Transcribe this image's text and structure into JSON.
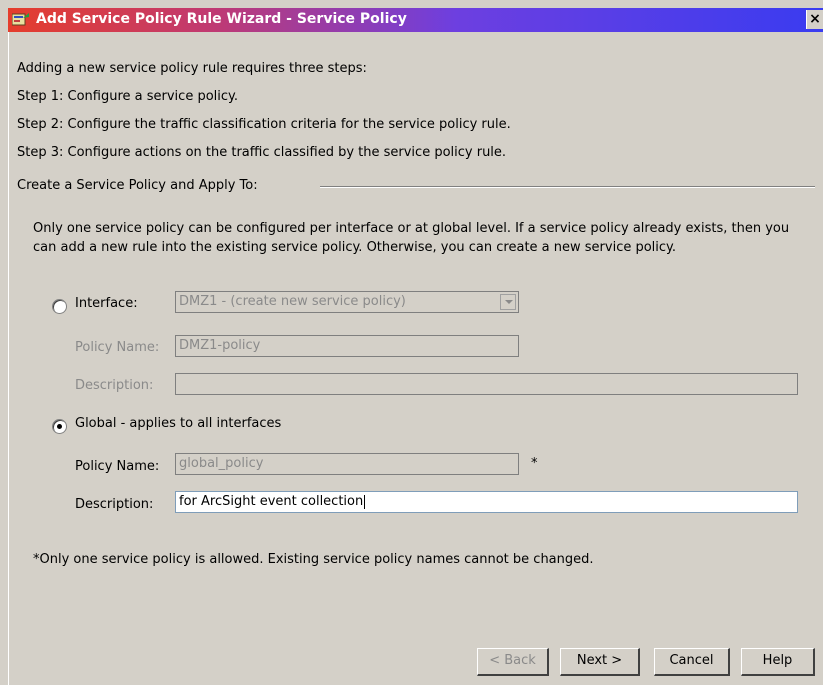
{
  "window": {
    "title": "Add Service Policy Rule Wizard - Service Policy",
    "close_glyph": "×"
  },
  "intro": {
    "line1": "Adding a new service policy rule requires three steps:",
    "step1": "Step 1:  Configure a service policy.",
    "step2": "Step 2:  Configure the traffic classification criteria for the service policy rule.",
    "step3": "Step 3:  Configure actions on the traffic classified by the service policy rule."
  },
  "group": {
    "label": "Create a Service Policy and Apply To:",
    "description": "Only one service policy can be configured per interface or at global level. If a service policy already exists, then you can add a new rule into the existing service policy. Otherwise, you can create a new service policy."
  },
  "interface_option": {
    "label": "Interface:",
    "selected": false,
    "combo_value": "DMZ1 - (create new service policy)",
    "policy_name_label": "Policy Name:",
    "policy_name_value": "DMZ1-policy",
    "description_label": "Description:",
    "description_value": ""
  },
  "global_option": {
    "label": "Global - applies to all interfaces",
    "selected": true,
    "policy_name_label": "Policy Name:",
    "policy_name_value": "global_policy",
    "required_mark": "*",
    "description_label": "Description:",
    "description_value": "for ArcSight event collection"
  },
  "footnote": "*Only one service policy is allowed. Existing service policy names cannot be changed.",
  "buttons": {
    "back": "< Back",
    "next": "Next >",
    "cancel": "Cancel",
    "help": "Help"
  },
  "icons": {
    "window_icon": "wizard-app-icon",
    "combo_arrow": "chevron-down-icon"
  }
}
